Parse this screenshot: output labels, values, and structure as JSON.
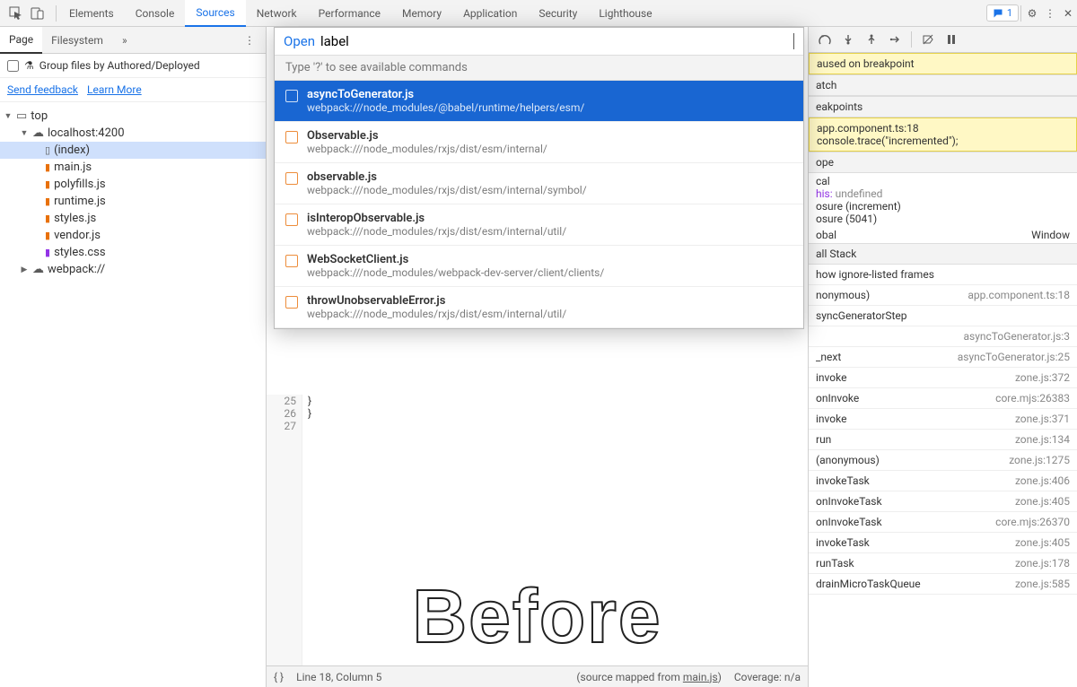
{
  "topTabs": [
    "Elements",
    "Console",
    "Sources",
    "Network",
    "Performance",
    "Memory",
    "Application",
    "Security",
    "Lighthouse"
  ],
  "activeTopTab": "Sources",
  "feedbackCount": "1",
  "subTabs": {
    "page": "Page",
    "filesystem": "Filesystem"
  },
  "groupLabel": "Group files by Authored/Deployed",
  "sendFeedback": "Send feedback",
  "learnMore": "Learn More",
  "tree": {
    "top": "top",
    "host": "localhost:4200",
    "files": [
      "(index)",
      "main.js",
      "polyfills.js",
      "runtime.js",
      "styles.js",
      "vendor.js",
      "styles.css"
    ],
    "webpack": "webpack://"
  },
  "palette": {
    "openLabel": "Open",
    "input": "label",
    "hint": "Type '?' to see available commands",
    "items": [
      {
        "file": "asyncToGenerator.js",
        "path": "webpack:///node_modules/@babel/runtime/helpers/esm/"
      },
      {
        "file": "Observable.js",
        "path": "webpack:///node_modules/rxjs/dist/esm/internal/"
      },
      {
        "file": "observable.js",
        "path": "webpack:///node_modules/rxjs/dist/esm/internal/symbol/"
      },
      {
        "file": "isInteropObservable.js",
        "path": "webpack:///node_modules/rxjs/dist/esm/internal/util/"
      },
      {
        "file": "WebSocketClient.js",
        "path": "webpack:///node_modules/webpack-dev-server/client/clients/"
      },
      {
        "file": "throwUnobservableError.js",
        "path": "webpack:///node_modules/rxjs/dist/esm/internal/util/"
      }
    ]
  },
  "codeTail": {
    "l25": "25",
    "l26": "26",
    "l27": "27",
    "b1": "  }",
    "b2": "}"
  },
  "status": {
    "pos": "Line 18, Column 5",
    "mapped": "(source mapped from ",
    "mappedFile": "main.js",
    "mappedEnd": ")",
    "coverage": "Coverage: n/a"
  },
  "debug": {
    "paused": "aused on breakpoint",
    "watch": "atch",
    "breakpoints": "eakpoints",
    "bpFile": "app.component.ts:18",
    "bpCode": "console.trace(\"incremented\");",
    "scope": "ope",
    "local": "cal",
    "thisLbl": "his:",
    "thisVal": "undefined",
    "closure1": "osure (increment)",
    "closure2": "osure (5041)",
    "global": "obal",
    "globalVal": "Window",
    "callstack": "all Stack",
    "showIgnored": "how ignore-listed frames",
    "frames": [
      {
        "fn": "nonymous)",
        "loc": "app.component.ts:18"
      },
      {
        "fn": "syncGeneratorStep",
        "loc": ""
      },
      {
        "fn": "",
        "loc": "asyncToGenerator.js:3"
      },
      {
        "fn": "_next",
        "loc": "asyncToGenerator.js:25"
      },
      {
        "fn": "invoke",
        "loc": "zone.js:372"
      },
      {
        "fn": "onInvoke",
        "loc": "core.mjs:26383"
      },
      {
        "fn": "invoke",
        "loc": "zone.js:371"
      },
      {
        "fn": "run",
        "loc": "zone.js:134"
      },
      {
        "fn": "(anonymous)",
        "loc": "zone.js:1275"
      },
      {
        "fn": "invokeTask",
        "loc": "zone.js:406"
      },
      {
        "fn": "onInvokeTask",
        "loc": "zone.js:405"
      },
      {
        "fn": "onInvokeTask",
        "loc": "core.mjs:26370"
      },
      {
        "fn": "invokeTask",
        "loc": "zone.js:405"
      },
      {
        "fn": "runTask",
        "loc": "zone.js:178"
      },
      {
        "fn": "drainMicroTaskQueue",
        "loc": "zone.js:585"
      }
    ]
  },
  "overlay": "Before"
}
